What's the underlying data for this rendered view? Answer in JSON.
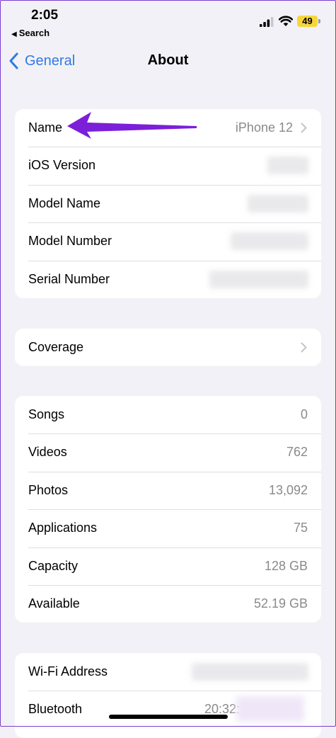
{
  "status_bar": {
    "time": "2:05",
    "back_app": "Search",
    "battery": "49",
    "battery_color": "#f7d63c"
  },
  "nav": {
    "back_label": "General",
    "title": "About",
    "accent": "#2f7ae5"
  },
  "device_info": [
    {
      "label": "Name",
      "value": "iPhone 12",
      "chevron": true
    },
    {
      "label": "iOS Version",
      "value": ""
    },
    {
      "label": "Model Name",
      "value": ""
    },
    {
      "label": "Model Number",
      "value": ""
    },
    {
      "label": "Serial Number",
      "value": ""
    }
  ],
  "coverage": {
    "label": "Coverage"
  },
  "media": [
    {
      "label": "Songs",
      "value": "0"
    },
    {
      "label": "Videos",
      "value": "762"
    },
    {
      "label": "Photos",
      "value": "13,092"
    },
    {
      "label": "Applications",
      "value": "75"
    },
    {
      "label": "Capacity",
      "value": "128 GB"
    },
    {
      "label": "Available",
      "value": "52.19 GB"
    }
  ],
  "network": [
    {
      "label": "Wi-Fi Address",
      "value": ""
    },
    {
      "label": "Bluetooth",
      "value": "20:32:"
    }
  ],
  "annotation": {
    "arrow_color": "#7b1fd8"
  }
}
